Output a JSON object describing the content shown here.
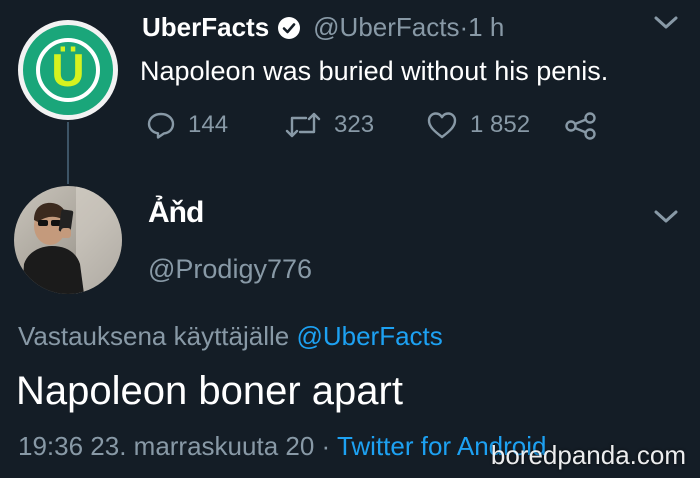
{
  "tweet": {
    "avatar_letter": "Ü",
    "display_name": "UberFacts",
    "handle": "@UberFacts",
    "separator": " · ",
    "time": "1 h",
    "text": "Napoleon was buried without his penis.",
    "replies": "144",
    "retweets": "323",
    "likes": "1 852"
  },
  "reply": {
    "display_name": "Ảňd",
    "handle": "@Prodigy776",
    "replying_prefix": "Vastauksena käyttäjälle ",
    "replying_to": "@UberFacts",
    "text": "Napoleon boner apart",
    "timestamp": "19:36 23. marraskuuta 20",
    "separator": " · ",
    "source": "Twitter for Android"
  },
  "watermark": "boredpanda.com",
  "colors": {
    "background": "#141d26",
    "secondary_text": "#8899a6",
    "link": "#1da1f2",
    "avatar_green": "#1aa67a",
    "avatar_letter": "#d6f21f"
  },
  "icons": [
    "verified-icon",
    "chevron-down-icon",
    "reply-icon",
    "retweet-icon",
    "like-icon",
    "share-icon"
  ]
}
